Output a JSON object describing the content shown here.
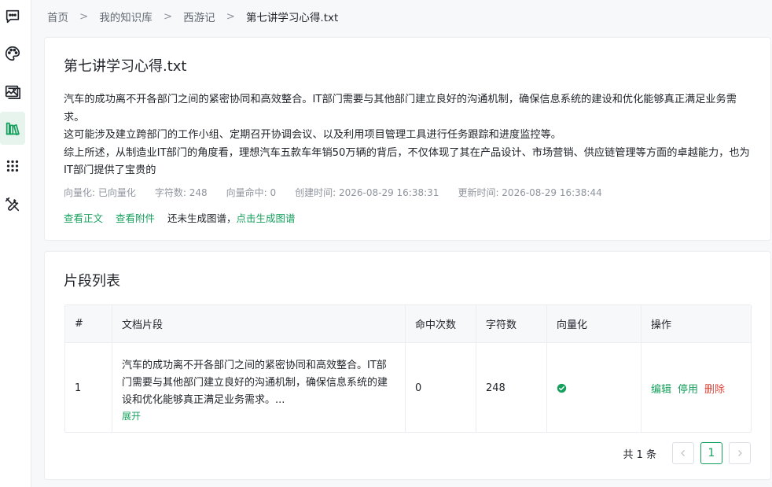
{
  "rail": {
    "items": [
      {
        "icon": "chat-icon"
      },
      {
        "icon": "palette-icon"
      },
      {
        "icon": "image-icon"
      },
      {
        "icon": "knowledge-base-icon",
        "active": true
      },
      {
        "icon": "apps-grid-icon"
      },
      {
        "icon": "tools-icon"
      }
    ]
  },
  "breadcrumb": {
    "home": "首页",
    "library": "我的知识库",
    "book": "西游记",
    "current": "第七讲学习心得.txt",
    "separator": ">"
  },
  "document": {
    "title": "第七讲学习心得.txt",
    "paragraphs": [
      "汽车的成功离不开各部门之间的紧密协同和高效整合。IT部门需要与其他部门建立良好的沟通机制，确保信息系统的建设和优化能够真正满足业务需求。",
      "这可能涉及建立跨部门的工作小组、定期召开协调会议、以及利用项目管理工具进行任务跟踪和进度监控等。",
      "综上所述，从制造业IT部门的角度看，理想汽车五款车年销50万辆的背后，不仅体现了其在产品设计、市场营销、供应链管理等方面的卓越能力，也为IT部门提供了宝贵的"
    ],
    "meta": {
      "vectorized": "向量化: 已向量化",
      "char_count": "字符数: 248",
      "vector_hits": "向量命中: 0",
      "created": "创建时间: 2026-08-29 16:38:31",
      "updated": "更新时间: 2026-08-29 16:38:44"
    },
    "actions": {
      "view_text": "查看正文",
      "view_attachment": "查看附件",
      "graph_status": "还未生成图谱，",
      "generate_graph": "点击生成图谱"
    }
  },
  "segments": {
    "title": "片段列表",
    "columns": [
      "#",
      "文档片段",
      "命中次数",
      "字符数",
      "向量化",
      "操作"
    ],
    "rows": [
      {
        "index": "1",
        "snippet": "汽车的成功离不开各部门之间的紧密协同和高效整合。IT部门需要与其他部门建立良好的沟通机制，确保信息系统的建设和优化能够真正满足业务需求。...",
        "expand": "展开",
        "hits": "0",
        "chars": "248",
        "vectorized": true,
        "ops": {
          "edit": "编辑",
          "disable": "停用",
          "delete": "删除"
        }
      }
    ],
    "pagination": {
      "total": "共 1 条",
      "current_page": "1"
    }
  },
  "colors": {
    "accent": "#16a05d",
    "danger": "#e0463b",
    "active_rail_bg": "#e7f4ed"
  }
}
